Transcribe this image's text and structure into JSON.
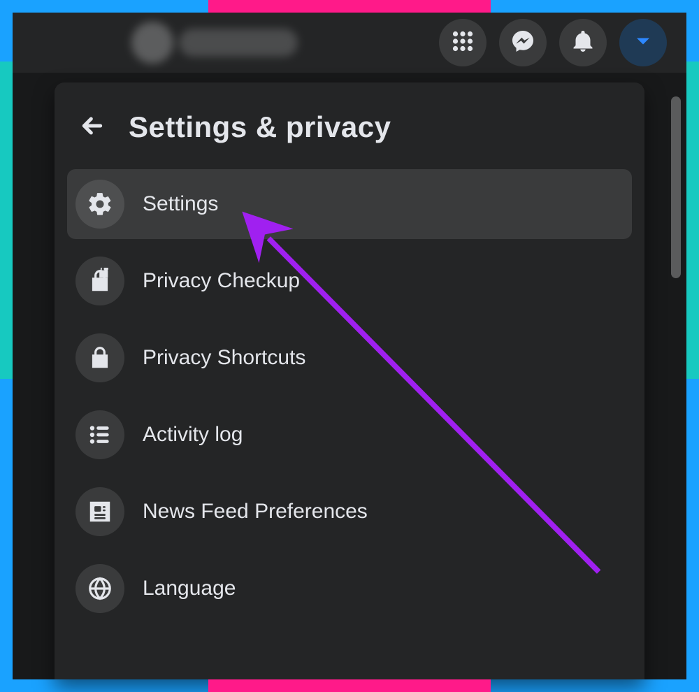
{
  "colors": {
    "bg": "#18191a",
    "surface": "#242526",
    "hover": "#3a3b3c",
    "text": "#e4e6eb",
    "accent": "#2d88ff",
    "annotation": "#a020f0"
  },
  "topbar": {
    "nav_buttons": [
      {
        "name": "menu-grid-icon"
      },
      {
        "name": "messenger-icon"
      },
      {
        "name": "bell-icon"
      },
      {
        "name": "caret-down-icon",
        "active": true
      }
    ]
  },
  "panel": {
    "title": "Settings & privacy",
    "items": [
      {
        "icon": "gear-icon",
        "label": "Settings",
        "highlighted": true
      },
      {
        "icon": "lock-heart-icon",
        "label": "Privacy Checkup"
      },
      {
        "icon": "lock-icon",
        "label": "Privacy Shortcuts"
      },
      {
        "icon": "list-icon",
        "label": "Activity log"
      },
      {
        "icon": "newspaper-icon",
        "label": "News Feed Preferences"
      },
      {
        "icon": "globe-icon",
        "label": "Language"
      }
    ]
  },
  "annotation": {
    "target_item_label": "Settings"
  }
}
